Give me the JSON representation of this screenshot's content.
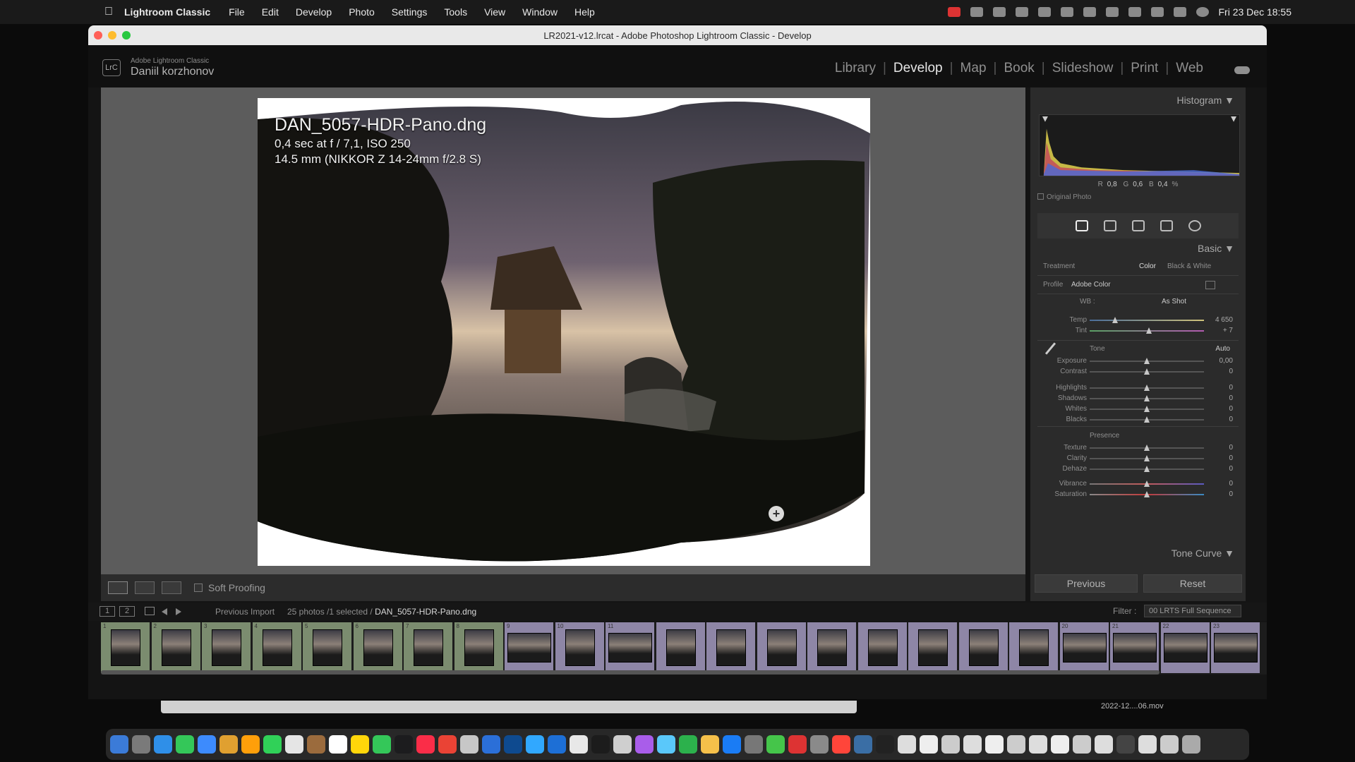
{
  "menubar": {
    "app_name": "Lightroom Classic",
    "menus": [
      "File",
      "Edit",
      "Develop",
      "Photo",
      "Settings",
      "Tools",
      "View",
      "Window",
      "Help"
    ],
    "clock": "Fri 23 Dec  18:55"
  },
  "window": {
    "title": "LR2021-v12.lrcat - Adobe Photoshop Lightroom Classic - Develop"
  },
  "identity": {
    "badge": "LrC",
    "product": "Adobe Lightroom Classic",
    "user": "Daniil korzhonov"
  },
  "modules": [
    "Library",
    "Develop",
    "Map",
    "Book",
    "Slideshow",
    "Print",
    "Web"
  ],
  "active_module": "Develop",
  "photo_info": {
    "filename": "DAN_5057-HDR-Pano.dng",
    "exposure_line": "0,4 sec at f / 7,1, ISO 250",
    "lens_line": "14.5 mm (NIKKOR Z 14-24mm f/2.8 S)"
  },
  "toolbar": {
    "soft_proofing": "Soft Proofing"
  },
  "right_panel": {
    "histogram_title": "Histogram",
    "histogram_readout": {
      "r_label": "R",
      "r": "0,8",
      "g_label": "G",
      "g": "0,6",
      "b_label": "B",
      "b": "0,4",
      "unit": "%"
    },
    "original_photo": "Original Photo",
    "basic_title": "Basic",
    "treatment_label": "Treatment",
    "treatment_color": "Color",
    "treatment_bw": "Black & White",
    "profile_label": "Profile",
    "profile_value": "Adobe Color",
    "wb_label": "WB :",
    "wb_value": "As Shot",
    "temp": {
      "label": "Temp",
      "value": "4 650",
      "position": 0.22
    },
    "tint": {
      "label": "Tint",
      "value": "+ 7",
      "position": 0.52
    },
    "tone_label": "Tone",
    "auto_label": "Auto",
    "tone_sliders": [
      {
        "label": "Exposure",
        "value": "0,00",
        "position": 0.5
      },
      {
        "label": "Contrast",
        "value": "0",
        "position": 0.5
      },
      {
        "label": "Highlights",
        "value": "0",
        "position": 0.5
      },
      {
        "label": "Shadows",
        "value": "0",
        "position": 0.5
      },
      {
        "label": "Whites",
        "value": "0",
        "position": 0.5
      },
      {
        "label": "Blacks",
        "value": "0",
        "position": 0.5
      }
    ],
    "presence_label": "Presence",
    "presence_sliders": [
      {
        "label": "Texture",
        "value": "0",
        "position": 0.5
      },
      {
        "label": "Clarity",
        "value": "0",
        "position": 0.5
      },
      {
        "label": "Dehaze",
        "value": "0",
        "position": 0.5
      },
      {
        "label": "Vibrance",
        "value": "0",
        "position": 0.5
      },
      {
        "label": "Saturation",
        "value": "0",
        "position": 0.5
      }
    ],
    "tone_curve_title": "Tone Curve",
    "previous_label": "Previous",
    "reset_label": "Reset"
  },
  "filmstrip": {
    "page1": "1",
    "page2": "2",
    "source": "Previous Import",
    "count_prefix": "25 photos /1 selected /",
    "selected_file": "DAN_5057-HDR-Pano.dng",
    "filter_label": "Filter :",
    "filter_value": "00 LRTS Full Sequence",
    "thumb_numbers": [
      "1",
      "2",
      "3",
      "4",
      "5",
      "6",
      "7",
      "8",
      "9",
      "10",
      "11",
      "",
      "",
      "",
      "",
      "",
      "",
      "",
      "",
      "20",
      "21",
      "22",
      "23"
    ],
    "selected_index": 10
  },
  "background": {
    "file_name": "2022-12....06.mov"
  },
  "dock_app_colors": [
    "#3b7bd8",
    "#7a7a7a",
    "#2f8fe8",
    "#34c759",
    "#3d8bfd",
    "#e0a030",
    "#ff9f0a",
    "#30d158",
    "#e5e5e5",
    "#9b6b3d",
    "#ffffff",
    "#ffd60a",
    "#34c759",
    "#1c1c1e",
    "#fa2d48",
    "#ea4335",
    "#c7c7c7",
    "#2b6fd8",
    "#0e4a8f",
    "#31a8ff",
    "#1d6fd6",
    "#e8e8e8",
    "#1c1c1c",
    "#cfcfcf",
    "#a95dea",
    "#5ac8fa",
    "#2cb14c",
    "#f5c04a",
    "#1a7cf5",
    "#777777",
    "#45c54a",
    "#d33",
    "#8a8a8a",
    "#ff453a",
    "#3a6ea5",
    "#222",
    "#ddd",
    "#eee",
    "#ccc",
    "#ddd",
    "#eee",
    "#ccc",
    "#ddd",
    "#eee",
    "#ccc",
    "#ddd",
    "#444",
    "#ddd",
    "#ccc",
    "#aaa"
  ]
}
